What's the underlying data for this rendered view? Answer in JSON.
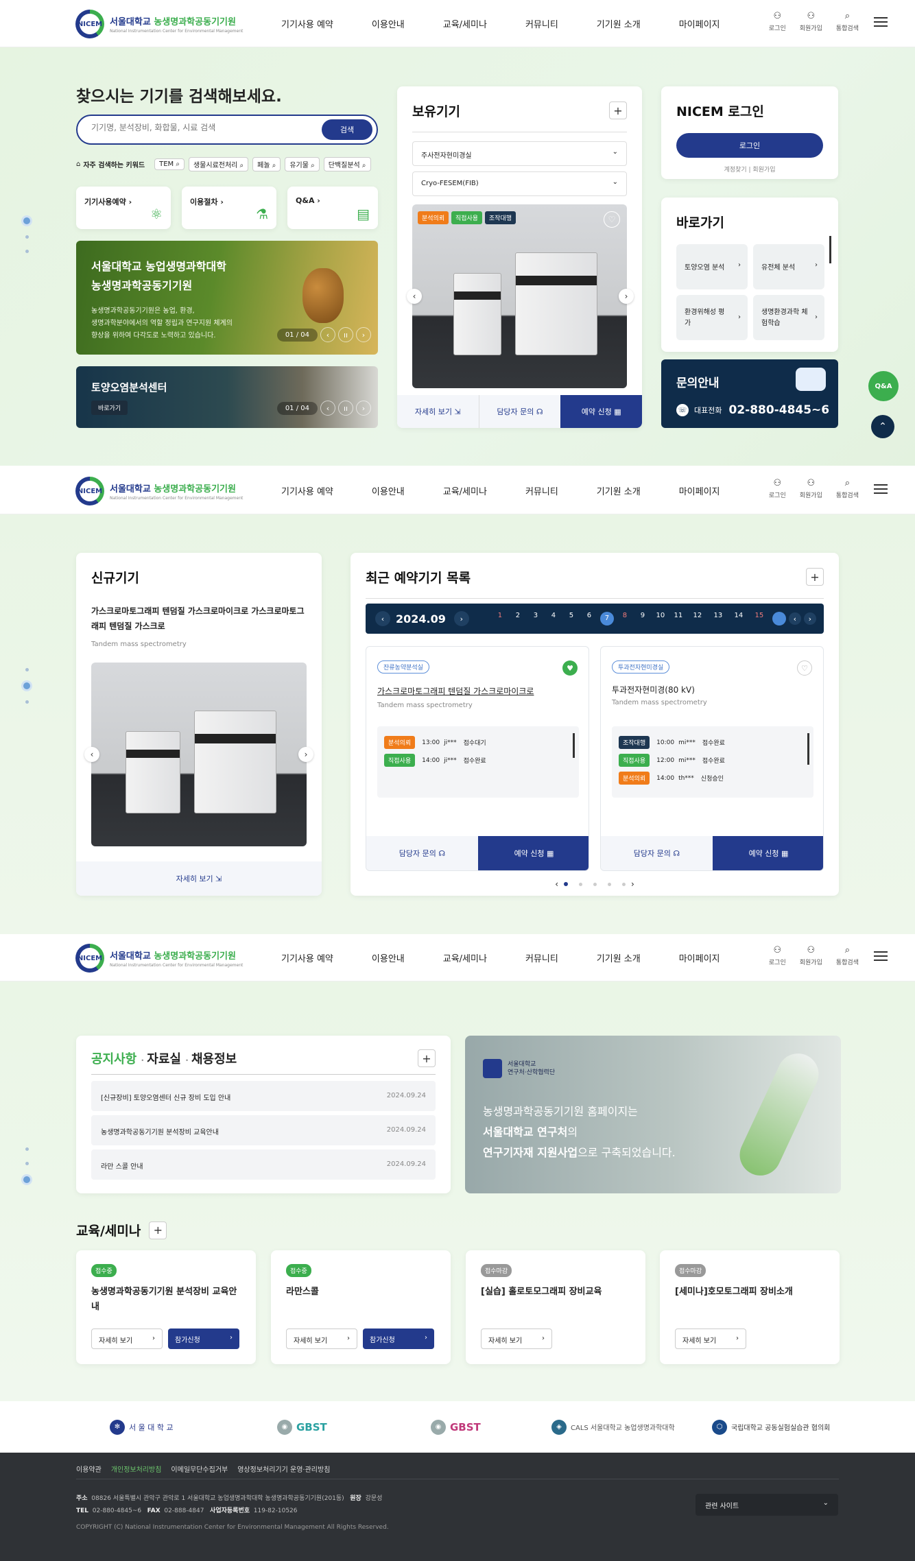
{
  "header": {
    "logo_mark": "NICEM",
    "logo_title_a": "서울대학교",
    "logo_title_b": "농생명과학공동기기원",
    "logo_sub": "National Instrumentation Center for Environmental Management",
    "nav": [
      "기기사용 예약",
      "이용안내",
      "교육/세미나",
      "커뮤니티",
      "기기원 소개",
      "마이페이지"
    ],
    "util": {
      "login": "로그인",
      "join": "회원가입",
      "search": "통합검색"
    }
  },
  "search": {
    "title": "찾으시는 기기를 검색해보세요.",
    "placeholder": "기기명, 분석장비, 화합물, 시료 검색",
    "button": "검색",
    "kw_label": "자주 검색하는 키워드",
    "keywords": [
      "TEM",
      "생물시료전처리",
      "페놀",
      "유기물",
      "단백질분석"
    ]
  },
  "quick": [
    {
      "label": "기기사용예약"
    },
    {
      "label": "이용절차"
    },
    {
      "label": "Q&A"
    }
  ],
  "banner1": {
    "title1": "서울대학교 농업생명과학대학",
    "title2": "농생명과학공동기기원",
    "desc1": "농생명과학공동기기원은 농업, 환경,",
    "desc2": "생명과학분야에서의 역할 정립과 연구지원 체계의",
    "desc3": "향상을 위하여 다각도로 노력하고 있습니다.",
    "page": "01 / 04"
  },
  "banner2": {
    "title": "토양오염분석센터",
    "btn": "바로가기",
    "page": "01 / 04"
  },
  "owned": {
    "title": "보유기기",
    "select1": "주사전자현미경실",
    "select2": "Cryo-FESEM(FIB)",
    "tags": [
      "분석의뢰",
      "직접사용",
      "조작대행"
    ],
    "detail": "자세히 보기",
    "contact": "담당자 문의",
    "reserve": "예약 신청"
  },
  "login": {
    "title": "NICEM 로그인",
    "button": "로그인",
    "find": "계정찾기",
    "join": "회원가입"
  },
  "shortcut": {
    "title": "바로가기",
    "items": [
      "토양오염 분석",
      "유전체 분석",
      "환경위해성 평가",
      "생명환경과학 체험학습"
    ]
  },
  "inquiry": {
    "title": "문의안내",
    "label": "대표전화",
    "phone": "02-880-4845~6"
  },
  "qa_float": "Q&A",
  "newdev": {
    "title": "신규기기",
    "name": "가스크로마토그래피 텐덤질 가스크로마이크로 가스크로마토그래피 텐덤질 가스크로",
    "sub": "Tandem mass spectrometry",
    "detail": "자세히 보기"
  },
  "recent": {
    "title": "최근 예약기기 목록",
    "month": "2024.09",
    "days": [
      "1",
      "2",
      "3",
      "4",
      "5",
      "6",
      "7",
      "8",
      "9",
      "10",
      "11",
      "12",
      "13",
      "14",
      "15"
    ],
    "cards": [
      {
        "badge": "잔류농약분석실",
        "name": "가스크로마토그래피 텐덤질 가스크로마이크로",
        "sub": "Tandem mass spectrometry",
        "rows": [
          {
            "tag": "분석의뢰",
            "time": "13:00",
            "user": "ji***",
            "status": "접수대기"
          },
          {
            "tag": "직접사용",
            "time": "14:00",
            "user": "ji***",
            "status": "접수완료"
          }
        ]
      },
      {
        "badge": "투과전자현미경실",
        "name": "투과전자현미경(80 kV)",
        "sub": "Tandem mass spectrometry",
        "rows": [
          {
            "tag": "조작대행",
            "time": "10:00",
            "user": "mi***",
            "status": "접수완료"
          },
          {
            "tag": "직접사용",
            "time": "12:00",
            "user": "mi***",
            "status": "접수완료"
          },
          {
            "tag": "분석의뢰",
            "time": "14:00",
            "user": "th***",
            "status": "신청승인"
          }
        ]
      }
    ],
    "contact": "담당자 문의",
    "reserve": "예약 신청"
  },
  "notice": {
    "tab1": "공지사항",
    "tab2": "자료실",
    "tab3": "채용정보",
    "items": [
      {
        "title": "[신규장비] 토양오염센터 신규 장비 도입 안내",
        "date": "2024.09.24"
      },
      {
        "title": "농생명과학공동기기원 분석장비 교육안내",
        "date": "2024.09.24"
      },
      {
        "title": "라만 스콜 안내",
        "date": "2024.09.24"
      }
    ]
  },
  "promo": {
    "org1": "서울대학교",
    "org2": "연구처·산학협력단",
    "line1": "농생명과학공동기기원 홈페이지는",
    "line2a": "서울대학교 연구처",
    "line2b": "의",
    "line3a": "연구기자재 지원사업",
    "line3b": "으로 구축되었습니다."
  },
  "edu": {
    "title": "교육/세미나",
    "detail": "자세히 보기",
    "apply": "참가신청",
    "cards": [
      {
        "status": "접수중",
        "title": "농생명과학공동기기원 분석장비 교육안내",
        "open": true
      },
      {
        "status": "접수중",
        "title": "라만스콜",
        "open": true
      },
      {
        "status": "접수마감",
        "title": "[실습] 홀로토모그래피 장비교육",
        "open": false
      },
      {
        "status": "접수마감",
        "title": "[세미나]호모토그래피 장비소개",
        "open": false
      }
    ]
  },
  "partners": [
    "서 울 대 학 교",
    "GBST",
    "GBST",
    "CALS 서울대학교 농업생명과학대학",
    "국립대학교 공동실험실습관 협의회"
  ],
  "footer": {
    "links": [
      "이용약관",
      "개인정보처리방침",
      "이메일무단수집거부",
      "영상정보처리기기 운영·관리방침"
    ],
    "addr_label": "주소",
    "addr": "08826 서울특별시 관악구 관악로 1 서울대학교 농업생명과학대학 농생명과학공동기기원(201동)",
    "head_label": "원장",
    "head": "강문성",
    "tel_label": "TEL",
    "tel": "02-880-4845~6",
    "fax_label": "FAX",
    "fax": "02-888-4847",
    "biz_label": "사업자등록번호",
    "biz": "119-82-10526",
    "copyright": "COPYRIGHT (C) National Instrumentation Center for Environmental Management All Rights Reserved.",
    "related": "관련 사이트"
  },
  "colors": {
    "navy": "#233a8c",
    "green": "#3cae4e",
    "dark": "#0f2c4a"
  }
}
